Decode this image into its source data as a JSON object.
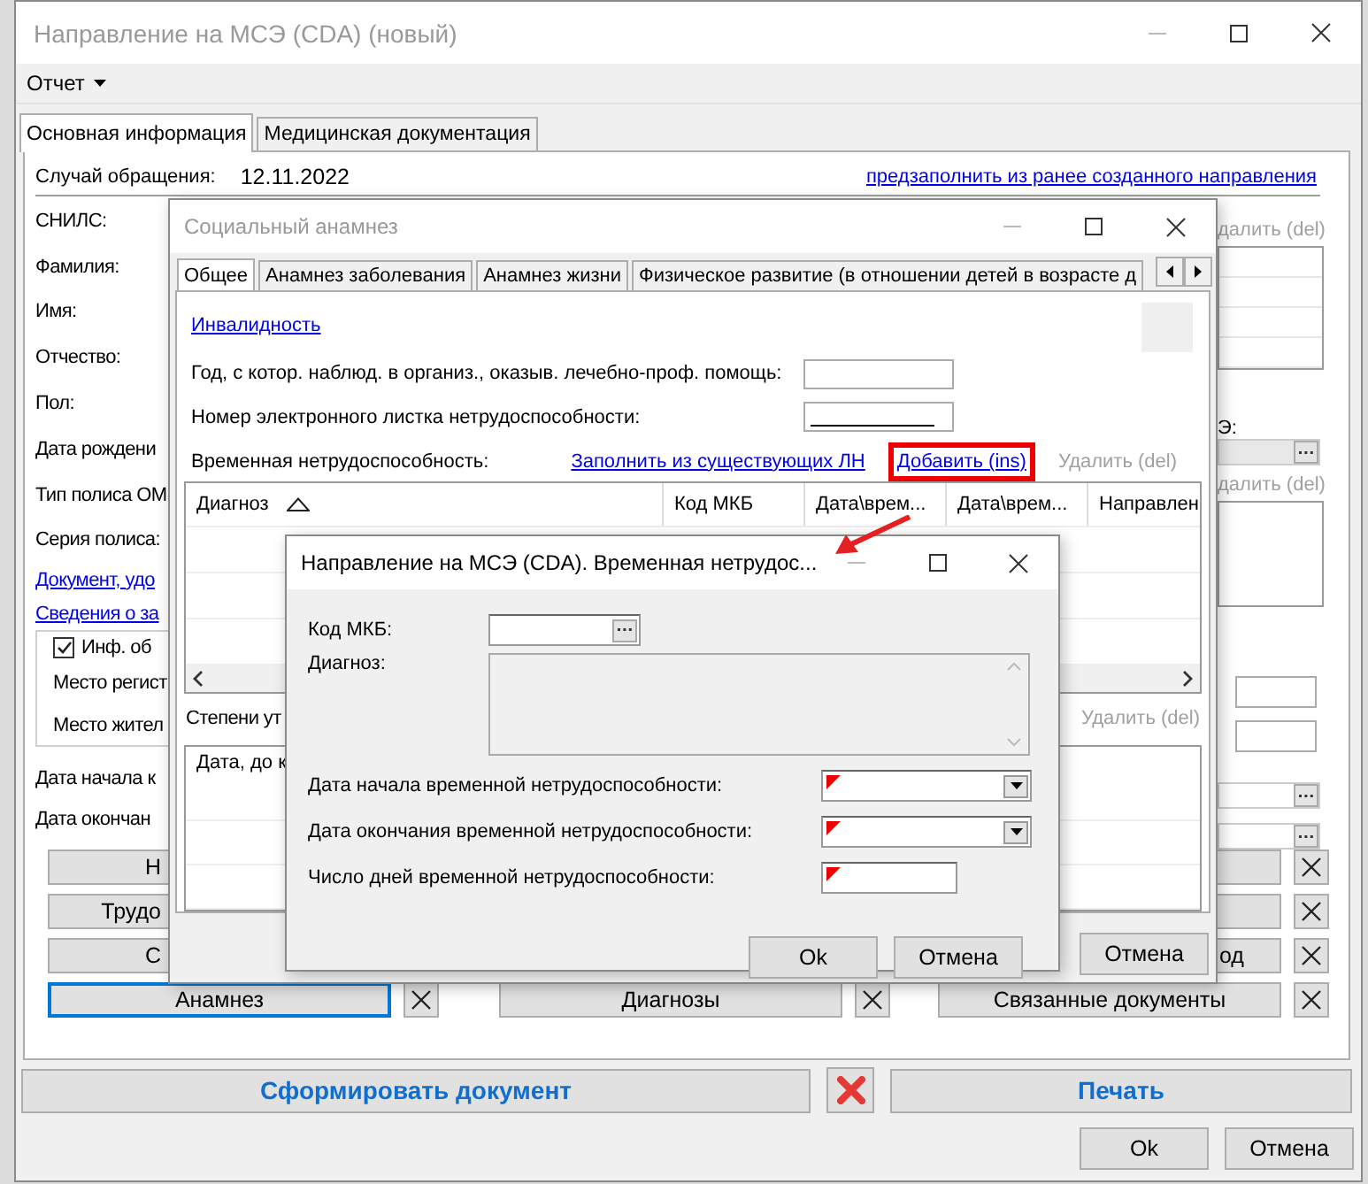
{
  "main_window": {
    "title": "Направление на МСЭ (CDA) (новый)",
    "menu": [
      {
        "label": "Отчет"
      }
    ],
    "tabs": [
      {
        "label": "Основная информация",
        "selected": true
      },
      {
        "label": "Медицинская документация",
        "selected": false
      }
    ],
    "case_label": "Случай обращения:",
    "case_date": "12.11.2022",
    "prefill_link": "предзаполнить из ранее созданного направления",
    "left_items": [
      {
        "kind": "label",
        "text": "СНИЛС:"
      },
      {
        "kind": "label",
        "text": "Фамилия:"
      },
      {
        "kind": "label",
        "text": "Имя:"
      },
      {
        "kind": "label",
        "text": "Отчество:"
      },
      {
        "kind": "label",
        "text": "Пол:"
      },
      {
        "kind": "label",
        "text": "Дата рождени"
      },
      {
        "kind": "label",
        "text": "Тип полиса ОМ"
      },
      {
        "kind": "label",
        "text": "Серия полиса:"
      },
      {
        "kind": "link",
        "text": "Документ, удо"
      },
      {
        "kind": "link",
        "text": "Сведения о за"
      }
    ],
    "address_group": {
      "checkbox": {
        "label": "Инф. об",
        "checked": true
      },
      "labels": [
        "Место регист",
        "Место жител"
      ]
    },
    "date_labels": [
      "Дата начала к",
      "Дата окончан"
    ],
    "right_fragments": {
      "delete_links": [
        "далить (del)",
        "далить (del)"
      ],
      "field_label": "Э:"
    },
    "section_rows": [
      {
        "left": {
          "label": "Н",
          "focused": false
        },
        "right": {
          "focused": false,
          "remove_button": true
        }
      },
      {
        "left": {
          "label": "Трудо",
          "focused": false
        },
        "right": {
          "focused": false,
          "remove_button": true
        }
      },
      {
        "left": {
          "label": "С",
          "focused": false
        },
        "right": {
          "label": "од",
          "focused": false,
          "remove_button": true
        }
      },
      {
        "left": {
          "label": "Анамнез",
          "focused": true,
          "remove_button": true
        },
        "middle": {
          "label": "Диагнозы",
          "focused": false,
          "remove_button": true
        },
        "right": {
          "label": "Связанные документы",
          "focused": false,
          "remove_button": true
        }
      }
    ],
    "generate_button": "Сформировать документ",
    "print_button": "Печать",
    "ok_button": "Ok",
    "cancel_button": "Отмена"
  },
  "social_dialog": {
    "title": "Социальный анамнез",
    "tabs": [
      {
        "label": "Общее",
        "selected": true
      },
      {
        "label": "Анамнез заболевания",
        "selected": false
      },
      {
        "label": "Анамнез жизни",
        "selected": false
      },
      {
        "label": "Физическое развитие (в отношении детей в возрасте д",
        "selected": false
      }
    ],
    "disability_link": "Инвалидность",
    "year_label": "Год, с котор. наблюд. в организ., оказыв. лечебно-проф. помощь:",
    "sick_leave_label": "Номер электронного листка нетрудоспособности:",
    "sick_leave_mask": true,
    "temp_label": "Временная нетрудоспособность:",
    "temp_links": [
      {
        "text": "Заполнить из существующих ЛН",
        "disabled": false,
        "highlighted": false
      },
      {
        "text": "Добавить (ins)",
        "disabled": false,
        "highlighted": true
      },
      {
        "text": "Удалить (del)",
        "disabled": true,
        "highlighted": false
      }
    ],
    "temp_columns": [
      {
        "title": "Диагноз",
        "sorted": true
      },
      {
        "title": "Код МКБ",
        "sorted": false
      },
      {
        "title": "Дата\\врем...",
        "sorted": false
      },
      {
        "title": "Дата\\врем...",
        "sorted": false
      },
      {
        "title": "Направлен",
        "sorted": false
      }
    ],
    "degrees_label": "Степени ут",
    "degrees_delete": {
      "text": "Удалить (del)",
      "disabled": true
    },
    "degrees_column": "Дата, до к",
    "cancel_button": "Отмена"
  },
  "icd_dialog": {
    "title": "Направление на МСЭ (CDA). Временная нетрудос...",
    "fields": [
      {
        "kind": "lookup",
        "label": "Код МКБ:",
        "required": false
      },
      {
        "kind": "memo",
        "label": "Диагноз:",
        "required": false
      },
      {
        "kind": "date",
        "label": "Дата начала временной нетрудоспособности:",
        "required": true
      },
      {
        "kind": "date",
        "label": "Дата окончания временной нетрудоспособности:",
        "required": true
      },
      {
        "kind": "number",
        "label": "Число дней временной нетрудоспособности:",
        "required": true
      }
    ],
    "ok_button": "Ok",
    "cancel_button": "Отмена"
  }
}
